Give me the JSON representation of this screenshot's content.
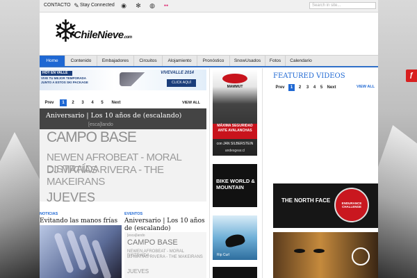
{
  "topbar": {
    "contact": "CONTACTO",
    "stay_connected": "Stay Connected",
    "search_placeholder": "Search in site..."
  },
  "logo": {
    "brand": "ChileNieve",
    "suffix": ".com"
  },
  "nav": {
    "items": [
      {
        "label": "Home",
        "active": true
      },
      {
        "label": "Contenido"
      },
      {
        "label": "Embajadores"
      },
      {
        "label": "Circuitos"
      },
      {
        "label": "Alojamiento"
      },
      {
        "label": "Pronóstico"
      },
      {
        "label": "SnowUsados"
      },
      {
        "label": "Fotos"
      },
      {
        "label": "Calendario"
      }
    ]
  },
  "banner": {
    "line1": "HOY EN VALLE",
    "line2": "VIVE TU MEJOR TEMPORADA JUNTO A ESTOS SKI PACKAGE",
    "brand": "VIVEVALLE 2014",
    "cta": "CLICK AQUÍ"
  },
  "pager_main": {
    "prev": "Prev",
    "pages": [
      "1",
      "2",
      "3",
      "4",
      "5"
    ],
    "current": "1",
    "next": "Next",
    "view_all": "VIEW ALL"
  },
  "slider": {
    "caption": "Aniversario | Los 10 años de (escalando)",
    "esc": "[esca]lando",
    "campo": "CAMPO BASE",
    "line1": "NEWEN AFROBEAT - MORAL DISTRAÍDA",
    "line2": "DJ MATÍAS RIVERA - THE MAKEIRANS",
    "jueves": "JUEVES"
  },
  "noticias": {
    "tag": "NOTICIAS",
    "title": "Evitando las manos frías"
  },
  "eventos": {
    "tag": "EVENTOS",
    "title": "Aniversario | Los 10 años de (escalando)",
    "thumb_top": "[esca]lando",
    "thumb_main": "CAMPO BASE",
    "thumb_l1": "NEWEN AFROBEAT - MORAL DISTRAÍDA",
    "thumb_l2": "DJ MATÍAS RIVERA - THE MAKEIRANS",
    "thumb_l3": "JUEVES"
  },
  "ads": {
    "mammut_brand": "MAMMUT",
    "mammut_headline": "MÁXIMA SEGURIDAD ANTE AVALANCHAS",
    "mammut_sub": "con JAN SILBERSTEIN",
    "mammut_url": "andesgear.cl",
    "bike": "BIKE WORLD & MOUNTAIN",
    "surf_brand": "Rip Curl",
    "tnf": "THE NORTH FACE",
    "tnf_badge": "ENDURANCE CHALLENGE"
  },
  "featured": {
    "title": "FEATURED VIDEOS",
    "pager": {
      "prev": "Prev",
      "pages": [
        "1",
        "2",
        "3",
        "4",
        "5"
      ],
      "current": "1",
      "next": "Next",
      "view_all": "VIEW ALL"
    }
  },
  "colors": {
    "accent": "#1f68d3",
    "mammut_red": "#c8131c",
    "flash_red": "#d81f1f"
  },
  "icons": [
    "pencil-icon",
    "rss-icon",
    "snowflake-icon",
    "camera-icon",
    "flickr-icon",
    "flash-player-icon"
  ]
}
